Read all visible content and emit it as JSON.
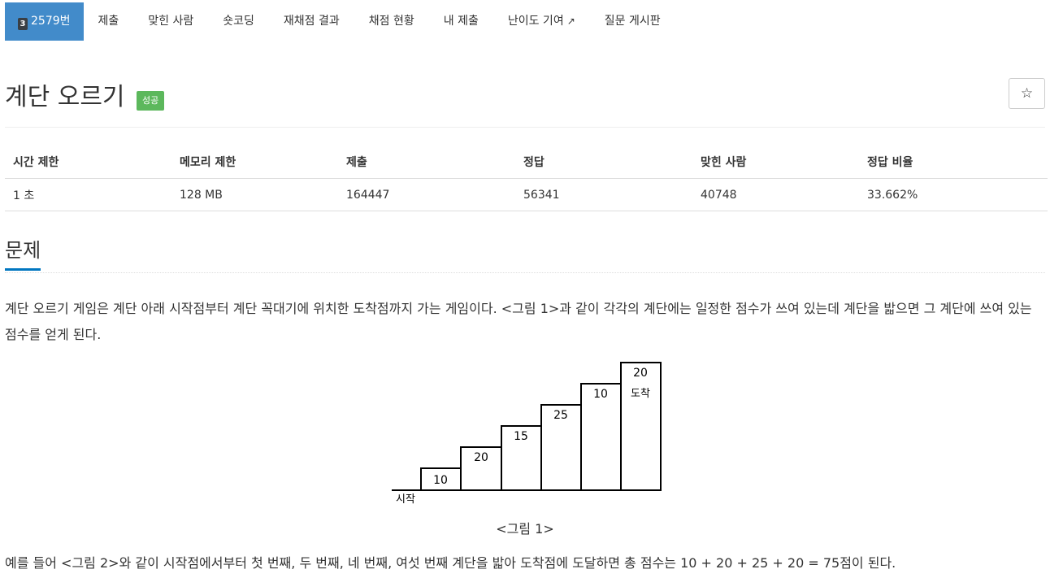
{
  "nav": {
    "problem": {
      "tier": "3",
      "label": "2579번"
    },
    "items": [
      "제출",
      "맞힌 사람",
      "숏코딩",
      "재채점 결과",
      "채점 현황",
      "내 제출",
      "난이도 기여",
      "질문 게시판"
    ]
  },
  "problem": {
    "title": "계단 오르기",
    "status_badge": "성공",
    "star": "☆"
  },
  "info_table": {
    "headers": [
      "시간 제한",
      "메모리 제한",
      "제출",
      "정답",
      "맞힌 사람",
      "정답 비율"
    ],
    "values": [
      "1 초",
      "128 MB",
      "164447",
      "56341",
      "40748",
      "33.662%"
    ]
  },
  "section": {
    "title": "문제",
    "paragraph1": "계단 오르기 게임은 계단 아래 시작점부터 계단 꼭대기에 위치한 도착점까지 가는 게임이다. <그림 1>과 같이 각각의 계단에는 일정한 점수가 쓰여 있는데 계단을 밟으면 그 계단에 쓰여 있는 점수를 얻게 된다.",
    "figure": {
      "steps": [
        "10",
        "20",
        "15",
        "25",
        "10",
        "20"
      ],
      "start_label": "시작",
      "end_label": "도착",
      "caption": "<그림 1>"
    },
    "paragraph2": "예를 들어 <그림 2>와 같이 시작점에서부터 첫 번째, 두 번째, 네 번째, 여섯 번째 계단을 밟아 도착점에 도달하면 총 점수는 10 + 20 + 25 + 20 = 75점이 된다."
  },
  "colors": {
    "active_tab": "#428bca",
    "success_badge": "#5cb85c",
    "section_underline": "#0076c0"
  }
}
